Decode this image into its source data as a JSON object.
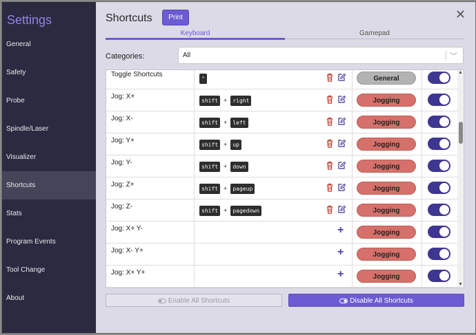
{
  "sidebar": {
    "title": "Settings",
    "items": [
      {
        "label": "General"
      },
      {
        "label": "Safety"
      },
      {
        "label": "Probe"
      },
      {
        "label": "Spindle/Laser"
      },
      {
        "label": "Visualizer"
      },
      {
        "label": "Shortcuts"
      },
      {
        "label": "Stats"
      },
      {
        "label": "Program Events"
      },
      {
        "label": "Tool Change"
      },
      {
        "label": "About"
      }
    ],
    "active_item": "Shortcuts"
  },
  "header": {
    "title": "Shortcuts",
    "print_label": "Print",
    "close_glyph": "✕"
  },
  "tabs": [
    {
      "label": "Keyboard",
      "active": true
    },
    {
      "label": "Gamepad",
      "active": false
    }
  ],
  "categories": {
    "label": "Categories:",
    "selected": "All"
  },
  "shortcuts": [
    {
      "name": "Toggle Shortcuts",
      "keys": [
        "^"
      ],
      "category": "General",
      "enabled": true
    },
    {
      "name": "Jog: X+",
      "keys": [
        "shift",
        "right"
      ],
      "category": "Jogging",
      "enabled": true
    },
    {
      "name": "Jog: X-",
      "keys": [
        "shift",
        "left"
      ],
      "category": "Jogging",
      "enabled": true
    },
    {
      "name": "Jog: Y+",
      "keys": [
        "shift",
        "up"
      ],
      "category": "Jogging",
      "enabled": true
    },
    {
      "name": "Jog: Y-",
      "keys": [
        "shift",
        "down"
      ],
      "category": "Jogging",
      "enabled": true
    },
    {
      "name": "Jog: Z+",
      "keys": [
        "shift",
        "pageup"
      ],
      "category": "Jogging",
      "enabled": true
    },
    {
      "name": "Jog: Z-",
      "keys": [
        "shift",
        "pagedown"
      ],
      "category": "Jogging",
      "enabled": true
    },
    {
      "name": "Jog: X+ Y-",
      "keys": [],
      "category": "Jogging",
      "enabled": true
    },
    {
      "name": "Jog: X- Y+",
      "keys": [],
      "category": "Jogging",
      "enabled": true
    },
    {
      "name": "Jog: X+ Y+",
      "keys": [],
      "category": "Jogging",
      "enabled": true
    }
  ],
  "key_separator": "+",
  "footer": {
    "enable_all_label": "Enable All Shortcuts",
    "disable_all_label": "Disable All Shortcuts"
  },
  "icons": {
    "delete": "trash-icon",
    "edit": "edit-icon",
    "add": "plus-icon",
    "toggle": "toggle-icon"
  },
  "colors": {
    "accent": "#6c5bd3",
    "sidebar_bg": "#2b2a40",
    "jogging_pill": "#d6706a",
    "general_pill": "#b3b3b3",
    "toggle_on": "#3f3692",
    "delete_icon": "#c0392b"
  }
}
